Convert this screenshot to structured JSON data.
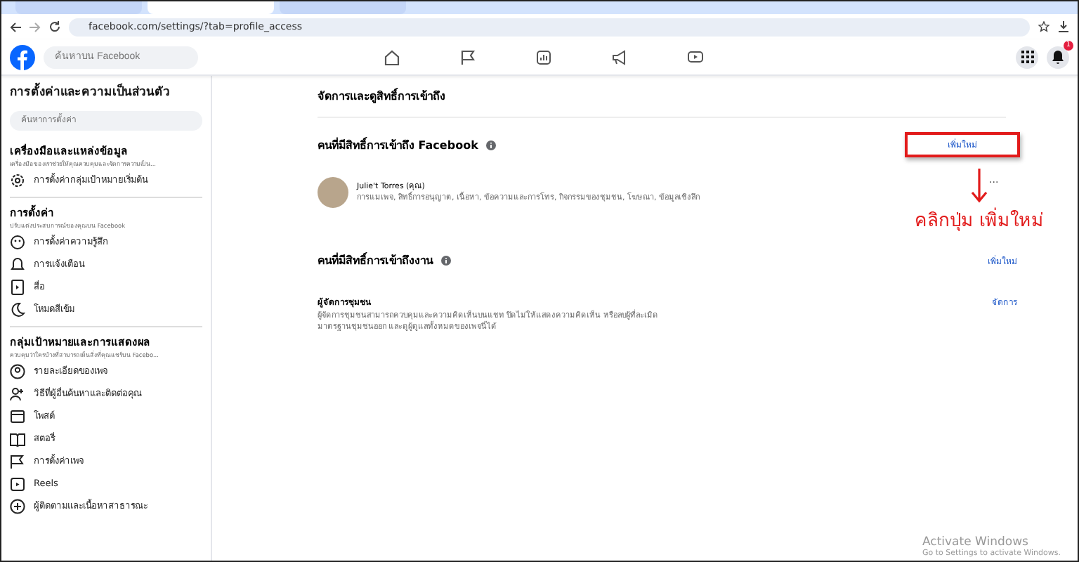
{
  "browser": {
    "url": "facebook.com/settings/?tab=profile_access",
    "tabs": [
      {
        "selected": false
      },
      {
        "selected": true
      },
      {
        "selected": false
      }
    ]
  },
  "header": {
    "search_placeholder": "ค้นหาบน Facebook",
    "notification_count": "1"
  },
  "sidebar": {
    "title": "การตั้งค่าและความเป็นส่วนตัว",
    "search_placeholder": "ค้นหาการตั้งค่า",
    "sections": [
      {
        "title": "เครื่องมือและแหล่งข้อมูล",
        "subtitle": "เครื่องมือของเราช่วยให้คุณควบคุมและจัดการความเป็น...",
        "items": [
          "การตั้งค่ากลุ่มเป้าหมายเริ่มต้น"
        ]
      },
      {
        "title": "การตั้งค่า",
        "subtitle": "ปรับแต่งประสบการณ์ของคุณบน Facebook",
        "items": [
          "การตั้งค่าความรู้สึก",
          "การแจ้งเตือน",
          "สื่อ",
          "โหมดสีเข้ม"
        ]
      },
      {
        "title": "กลุ่มเป้าหมายและการแสดงผล",
        "subtitle": "ควบคุมว่าใครบ้างที่สามารถเห็นสิ่งที่คุณแชร์บน Facebo...",
        "items": [
          "รายละเอียดของเพจ",
          "วิธีที่ผู้อื่นค้นหาและติดต่อคุณ",
          "โพสต์",
          "สตอรี่",
          "การตั้งค่าเพจ",
          "Reels",
          "ผู้ติดตามและเนื้อหาสาธารณะ"
        ]
      }
    ]
  },
  "main": {
    "title": "จัดการและดูสิทธิ์การเข้าถึง",
    "facebook_access": {
      "heading": "คนที่มีสิทธิ์การเข้าถึง Facebook",
      "add_button": "เพิ่มใหม่",
      "person": {
        "name": "Julie't Torres (คุณ)",
        "permissions": "การแมเพจ, สิทธิ์การอนุญาต, เนื้อหา, ข้อความและการโทร, กิจกรรมของชุมชน, โฆษณา, ข้อมูลเชิงลึก",
        "more": "..."
      }
    },
    "task_access": {
      "heading": "คนที่มีสิทธิ์การเข้าถึงงาน",
      "add_button": "เพิ่มใหม่",
      "role": {
        "title": "ผู้จัดการชุมชน",
        "description": "ผู้จัดการชุมชนสามารถควบคุมและความคิดเห็นบนแชท ปิดไม่ให้แสดงความคิดเห็น หรือลบผู้ที่ละเมิดมาตรฐานชุมชนออก และดูผู้ดูแลทั้งหมดของเพจนี้ได้",
        "action": "จัดการ"
      }
    }
  },
  "annotation": {
    "text": "คลิกปุ่ม เพิ่มใหม่"
  },
  "windows_notice": {
    "title": "Activate Windows",
    "subtitle": "Go to Settings to activate Windows."
  }
}
